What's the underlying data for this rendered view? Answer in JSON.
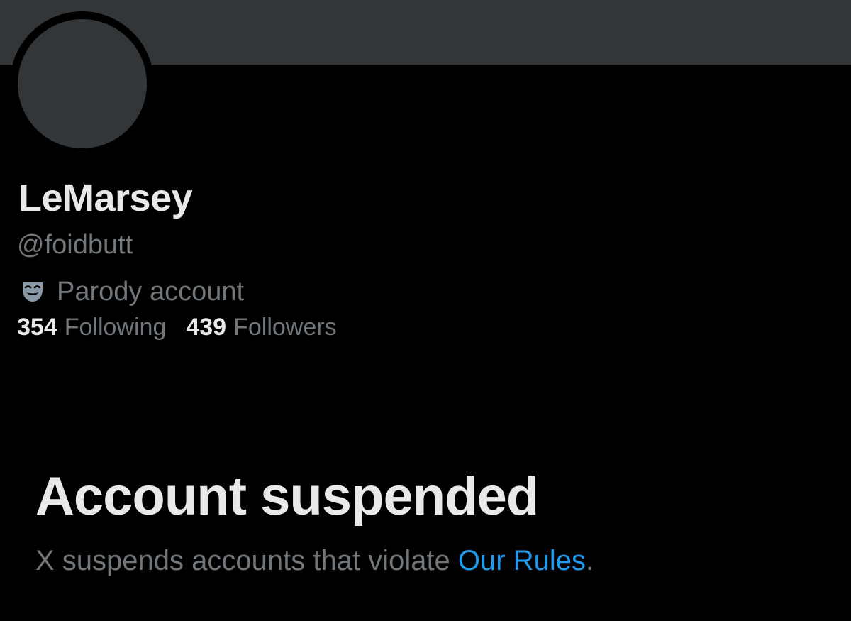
{
  "profile": {
    "display_name": "LeMarsey",
    "handle": "@foidbutt",
    "label_icon": "parody-mask-icon",
    "label_text": "Parody account",
    "following_count": "354",
    "following_label": "Following",
    "followers_count": "439",
    "followers_label": "Followers"
  },
  "suspension": {
    "title": "Account suspended",
    "description_prefix": "X suspends accounts that violate ",
    "rules_link": "Our Rules",
    "description_suffix": "."
  },
  "colors": {
    "background": "#000000",
    "banner": "#333639",
    "primary_text": "#e7e9ea",
    "secondary_text": "#71767b",
    "link": "#1d9bf0"
  }
}
